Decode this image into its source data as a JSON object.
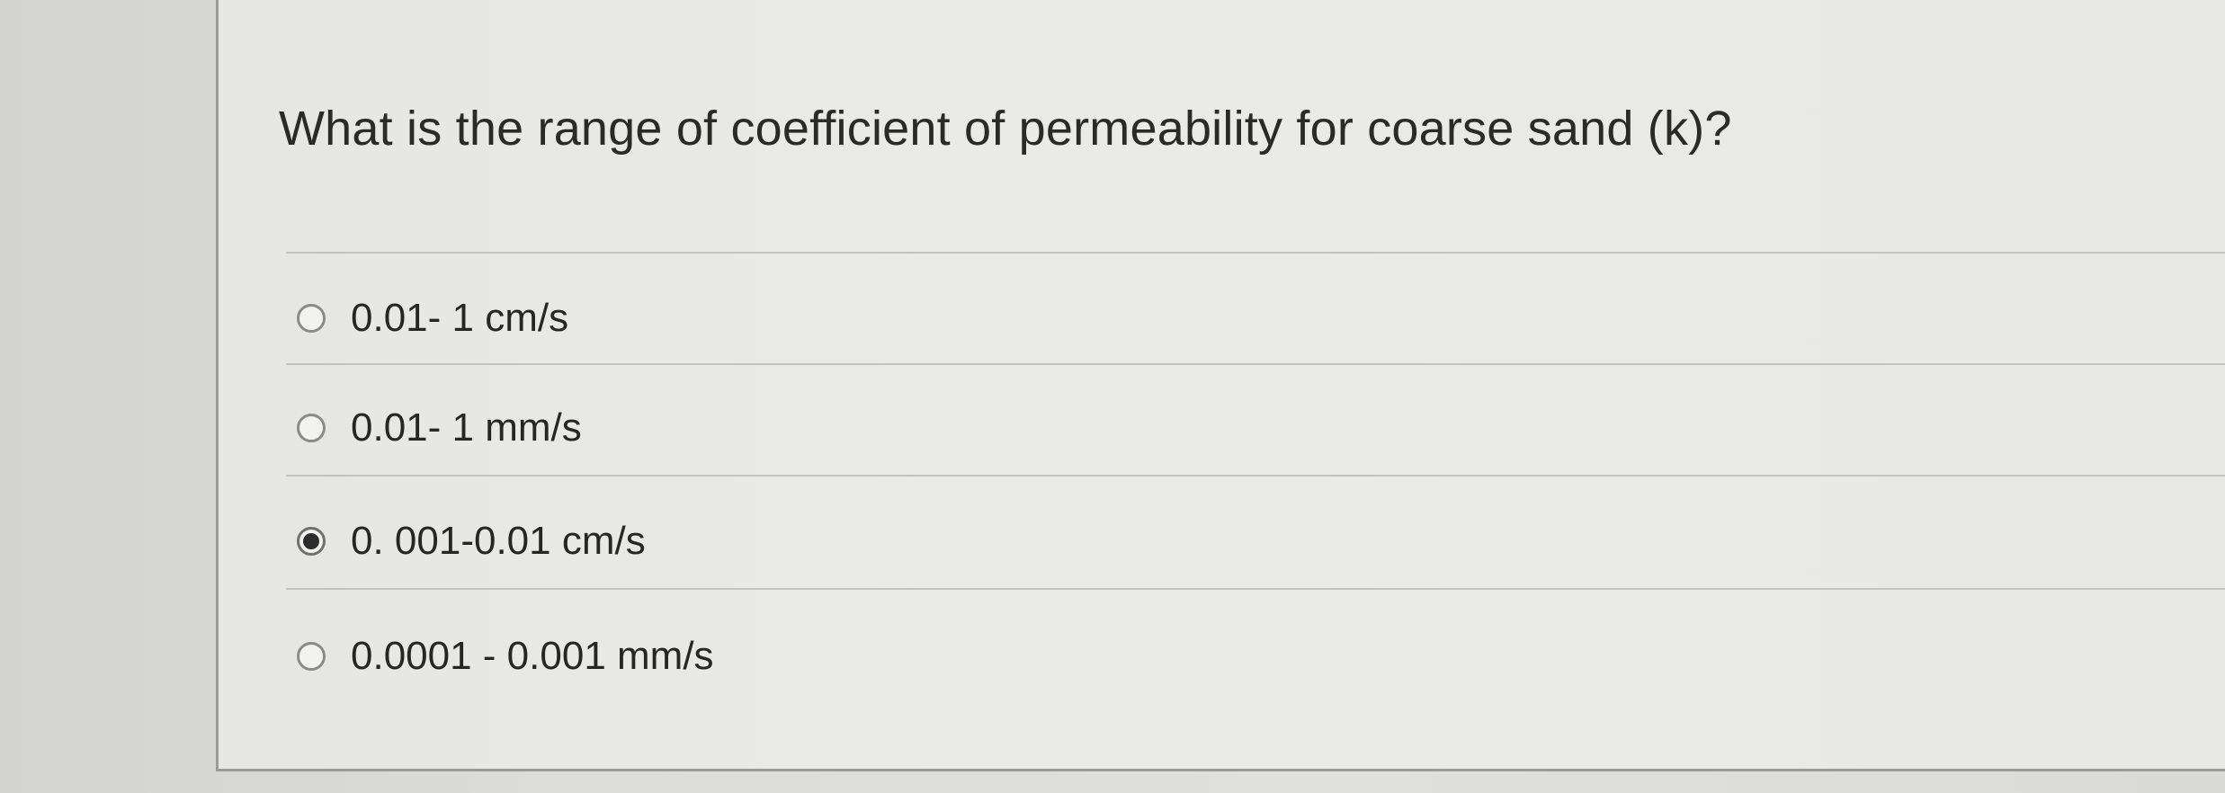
{
  "question": {
    "text": "What is the range of coefficient of permeability for coarse sand (k)?"
  },
  "options": [
    {
      "label": "0.01- 1 cm/s",
      "selected": false
    },
    {
      "label": "0.01- 1 mm/s",
      "selected": false
    },
    {
      "label": "0. 001-0.01 cm/s",
      "selected": true
    },
    {
      "label": "0.0001 - 0.001 mm/s",
      "selected": false
    }
  ],
  "colors": {
    "selected_dot": "#2c2c2c",
    "radio_border": "#8a8a88",
    "divider": "#c2c2c0"
  }
}
